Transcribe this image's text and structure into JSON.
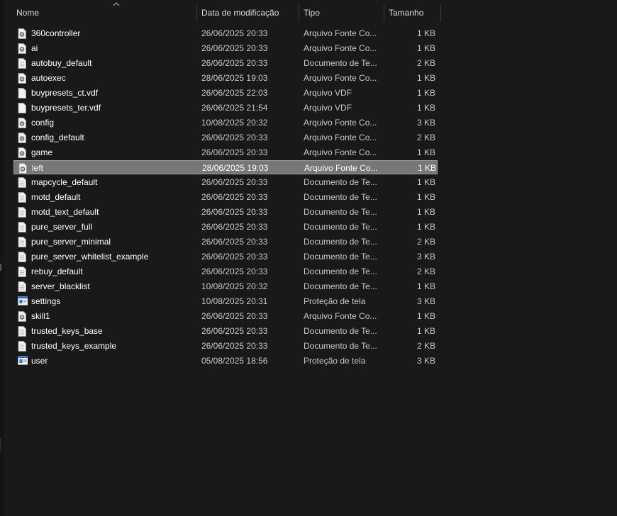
{
  "columns": {
    "name": "Nome",
    "modified": "Data de modificação",
    "type": "Tipo",
    "size": "Tamanho"
  },
  "files": [
    {
      "name": "360controller",
      "date": "26/06/2025 20:33",
      "type": "Arquivo Fonte Co...",
      "size": "1 KB",
      "icon": "gear-file-icon"
    },
    {
      "name": "ai",
      "date": "26/06/2025 20:33",
      "type": "Arquivo Fonte Co...",
      "size": "1 KB",
      "icon": "gear-file-icon"
    },
    {
      "name": "autobuy_default",
      "date": "26/06/2025 20:33",
      "type": "Documento de Te...",
      "size": "2 KB",
      "icon": "text-file-icon"
    },
    {
      "name": "autoexec",
      "date": "28/06/2025 19:03",
      "type": "Arquivo Fonte Co...",
      "size": "1 KB",
      "icon": "gear-file-icon"
    },
    {
      "name": "buypresets_ct.vdf",
      "date": "26/06/2025 22:03",
      "type": "Arquivo VDF",
      "size": "1 KB",
      "icon": "blank-file-icon"
    },
    {
      "name": "buypresets_ter.vdf",
      "date": "26/06/2025 21:54",
      "type": "Arquivo VDF",
      "size": "1 KB",
      "icon": "blank-file-icon"
    },
    {
      "name": "config",
      "date": "10/08/2025 20:32",
      "type": "Arquivo Fonte Co...",
      "size": "3 KB",
      "icon": "gear-file-icon"
    },
    {
      "name": "config_default",
      "date": "26/06/2025 20:33",
      "type": "Arquivo Fonte Co...",
      "size": "2 KB",
      "icon": "gear-file-icon"
    },
    {
      "name": "game",
      "date": "26/06/2025 20:33",
      "type": "Arquivo Fonte Co...",
      "size": "1 KB",
      "icon": "gear-file-icon"
    },
    {
      "name": "left",
      "date": "28/06/2025 19:03",
      "type": "Arquivo Fonte Co...",
      "size": "1 KB",
      "icon": "gear-file-icon",
      "selected": true
    },
    {
      "name": "mapcycle_default",
      "date": "26/06/2025 20:33",
      "type": "Documento de Te...",
      "size": "1 KB",
      "icon": "text-file-icon"
    },
    {
      "name": "motd_default",
      "date": "26/06/2025 20:33",
      "type": "Documento de Te...",
      "size": "1 KB",
      "icon": "text-file-icon"
    },
    {
      "name": "motd_text_default",
      "date": "26/06/2025 20:33",
      "type": "Documento de Te...",
      "size": "1 KB",
      "icon": "text-file-icon"
    },
    {
      "name": "pure_server_full",
      "date": "26/06/2025 20:33",
      "type": "Documento de Te...",
      "size": "1 KB",
      "icon": "text-file-icon"
    },
    {
      "name": "pure_server_minimal",
      "date": "26/06/2025 20:33",
      "type": "Documento de Te...",
      "size": "2 KB",
      "icon": "text-file-icon"
    },
    {
      "name": "pure_server_whitelist_example",
      "date": "26/06/2025 20:33",
      "type": "Documento de Te...",
      "size": "3 KB",
      "icon": "text-file-icon"
    },
    {
      "name": "rebuy_default",
      "date": "26/06/2025 20:33",
      "type": "Documento de Te...",
      "size": "2 KB",
      "icon": "text-file-icon"
    },
    {
      "name": "server_blacklist",
      "date": "10/08/2025 20:32",
      "type": "Documento de Te...",
      "size": "1 KB",
      "icon": "text-file-icon"
    },
    {
      "name": "settings",
      "date": "10/08/2025 20:31",
      "type": "Proteção de tela",
      "size": "3 KB",
      "icon": "screensaver-file-icon"
    },
    {
      "name": "skill1",
      "date": "26/06/2025 20:33",
      "type": "Arquivo Fonte Co...",
      "size": "1 KB",
      "icon": "gear-file-icon"
    },
    {
      "name": "trusted_keys_base",
      "date": "26/06/2025 20:33",
      "type": "Documento de Te...",
      "size": "1 KB",
      "icon": "text-file-icon"
    },
    {
      "name": "trusted_keys_example",
      "date": "26/06/2025 20:33",
      "type": "Documento de Te...",
      "size": "2 KB",
      "icon": "text-file-icon"
    },
    {
      "name": "user",
      "date": "05/08/2025 18:56",
      "type": "Proteção de tela",
      "size": "3 KB",
      "icon": "screensaver-file-icon"
    }
  ],
  "colors": {
    "background": "#191919",
    "selected_row": "#777777",
    "screensaver_accent": "#1e6fd9"
  }
}
